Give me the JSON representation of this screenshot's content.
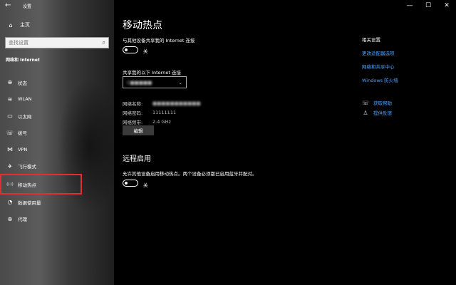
{
  "window": {
    "back_icon": "back-arrow-icon",
    "title": "设置",
    "controls": [
      "—",
      "☐",
      "✕"
    ]
  },
  "sidebar": {
    "home_label": "主页",
    "search_placeholder": "查找设置",
    "section_label": "网络和 Internet",
    "items": [
      {
        "icon": "globe-icon",
        "glyph": "⊕",
        "label": "状态"
      },
      {
        "icon": "wifi-icon",
        "glyph": "≋",
        "label": "WLAN"
      },
      {
        "icon": "ethernet-icon",
        "glyph": "▭",
        "label": "以太网"
      },
      {
        "icon": "dialup-icon",
        "glyph": "☏",
        "label": "拨号"
      },
      {
        "icon": "vpn-icon",
        "glyph": "⋈",
        "label": "VPN"
      },
      {
        "icon": "airplane-icon",
        "glyph": "✈",
        "label": "飞行模式"
      },
      {
        "icon": "hotspot-icon",
        "glyph": "((·))",
        "label": "移动热点",
        "active": true
      },
      {
        "icon": "data-usage-icon",
        "glyph": "◔",
        "label": "数据使用量"
      },
      {
        "icon": "proxy-icon",
        "glyph": "⊕",
        "label": "代理"
      }
    ]
  },
  "main": {
    "title": "移动热点",
    "share_label": "与其他设备共享我的 Internet 连接",
    "share_toggle_label": "关",
    "share_toggle_on": false,
    "from_label": "共享我的以下 Internet 连接",
    "connection_value": "C■■■■■",
    "network_name_key": "网络名称:",
    "network_name_value": "■■■■■■■■■■■",
    "password_key": "网络密码:",
    "password_value": "11111111",
    "band_key": "网络频带:",
    "band_value": "2.4 GHz",
    "edit_button": "编辑",
    "remote_title": "远程启用",
    "remote_desc": "允许其他设备启用移动热点。两个设备必须都已启用蓝牙并配对。",
    "remote_toggle_label": "关",
    "remote_toggle_on": false
  },
  "related": {
    "title": "相关设置",
    "links": [
      "更改适配器选项",
      "网络和共享中心",
      "Windows 防火墙"
    ]
  },
  "help": {
    "get_help": "获取帮助",
    "feedback": "提供反馈"
  },
  "colors": {
    "accent_link": "#4aa3ff",
    "highlight_box": "#e03030",
    "background": "#000000"
  }
}
